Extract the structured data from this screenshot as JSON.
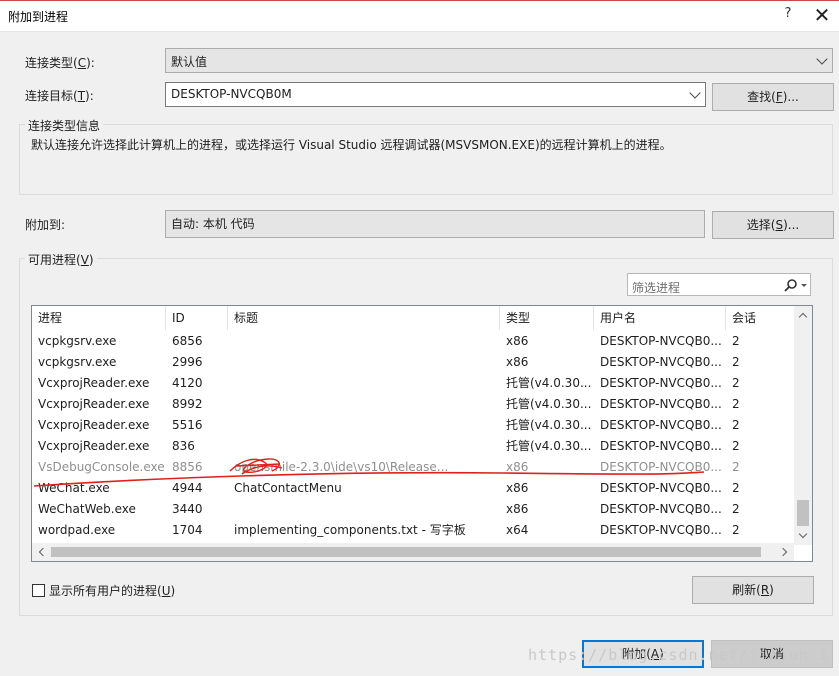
{
  "window": {
    "title": "附加到进程",
    "help_glyph": "?",
    "close_glyph": "✕"
  },
  "connection_type": {
    "label_prefix": "连接类型(",
    "label_key": "C",
    "label_suffix": "):",
    "value": "默认值"
  },
  "connection_target": {
    "label_prefix": "连接目标(",
    "label_key": "T",
    "label_suffix": "):",
    "value": "DESKTOP-NVCQB0M",
    "find_prefix": "查找(",
    "find_key": "F",
    "find_suffix": ")..."
  },
  "info_group": {
    "title": "连接类型信息",
    "text": "默认连接允许选择此计算机上的进程，或选择运行 Visual Studio 远程调试器(MSVSMON.EXE)的远程计算机上的进程。"
  },
  "attach_to": {
    "label": "附加到:",
    "value": "自动: 本机 代码",
    "select_prefix": "选择(",
    "select_key": "S",
    "select_suffix": ")..."
  },
  "processes_group": {
    "title_prefix": "可用进程(",
    "title_key": "V",
    "title_suffix": ")",
    "filter_placeholder": "筛选进程",
    "columns": [
      "进程",
      "ID",
      "标题",
      "类型",
      "用户名",
      "会话"
    ],
    "rows": [
      {
        "name": "vcpkgsrv.exe",
        "id": "6856",
        "title": "",
        "type": "x86",
        "user": "DESKTOP-NVCQB0...",
        "session": "2",
        "dim": false
      },
      {
        "name": "vcpkgsrv.exe",
        "id": "2996",
        "title": "",
        "type": "x86",
        "user": "DESKTOP-NVCQB0...",
        "session": "2",
        "dim": false
      },
      {
        "name": "VcxprojReader.exe",
        "id": "4120",
        "title": "",
        "type": "托管(v4.0.30...",
        "user": "DESKTOP-NVCQB0...",
        "session": "2",
        "dim": false
      },
      {
        "name": "VcxprojReader.exe",
        "id": "8992",
        "title": "",
        "type": "托管(v4.0.30...",
        "user": "DESKTOP-NVCQB0...",
        "session": "2",
        "dim": false
      },
      {
        "name": "VcxprojReader.exe",
        "id": "5516",
        "title": "",
        "type": "托管(v4.0.30...",
        "user": "DESKTOP-NVCQB0...",
        "session": "2",
        "dim": false
      },
      {
        "name": "VcxprojReader.exe",
        "id": "836",
        "title": "",
        "type": "托管(v4.0.30...",
        "user": "DESKTOP-NVCQB0...",
        "session": "2",
        "dim": false
      },
      {
        "name": "VsDebugConsole.exe",
        "id": "8856",
        "title": "opensmile-2.3.0\\ide\\vs10\\Release...",
        "type": "x86",
        "user": "DESKTOP-NVCQB0...",
        "session": "2",
        "dim": true
      },
      {
        "name": "WeChat.exe",
        "id": "4944",
        "title": "ChatContactMenu",
        "type": "x86",
        "user": "DESKTOP-NVCQB0...",
        "session": "2",
        "dim": false
      },
      {
        "name": "WeChatWeb.exe",
        "id": "3440",
        "title": "",
        "type": "x86",
        "user": "DESKTOP-NVCQB0...",
        "session": "2",
        "dim": false
      },
      {
        "name": "wordpad.exe",
        "id": "1704",
        "title": "implementing_components.txt - 写字板",
        "type": "x64",
        "user": "DESKTOP-NVCQB0...",
        "session": "2",
        "dim": false
      }
    ],
    "show_all_prefix": "显示所有用户的进程(",
    "show_all_key": "U",
    "show_all_suffix": ")",
    "refresh_prefix": "刷新(",
    "refresh_key": "R",
    "refresh_suffix": ")"
  },
  "footer": {
    "attach_prefix": "附加(",
    "attach_key": "A",
    "attach_suffix": ")",
    "cancel": "取消",
    "watermark": "https://blog.csdn.net/jiajun_1"
  },
  "colors": {
    "dialog_bg": "#f0f0f0",
    "accent": "#0078d7",
    "annotation": "#e0201b"
  }
}
